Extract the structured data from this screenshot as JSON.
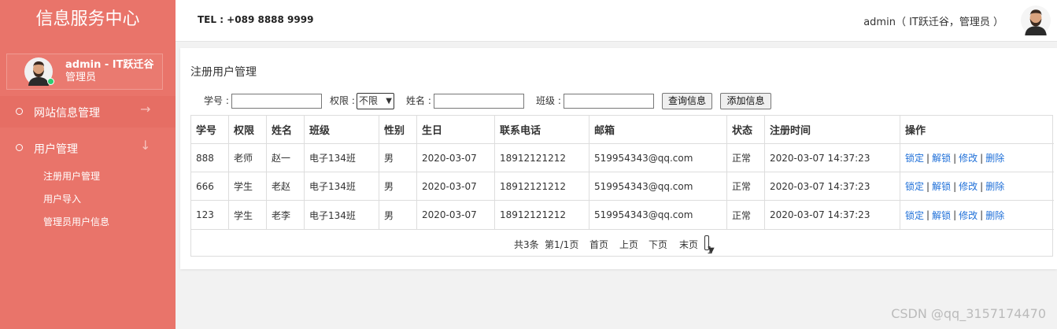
{
  "brand": "信息服务中心",
  "sidebar": {
    "user_name": "admin - IT跃迁谷",
    "user_role": "管理员",
    "nav": [
      {
        "label": "网站信息管理",
        "arrow": "→"
      },
      {
        "label": "用户管理",
        "arrow": "↓"
      }
    ],
    "sub_items": [
      "注册用户管理",
      "用户导入",
      "管理员用户信息"
    ]
  },
  "header": {
    "tel": "TEL : +089 8888 9999",
    "user": "admin（ IT跃迁谷，管理员 ）"
  },
  "panel": {
    "title": "注册用户管理",
    "filters": {
      "id_label": "学号 :",
      "perm_label": "权限 :",
      "perm_value": "不限",
      "name_label": "姓名 :",
      "class_label": "班级 :"
    },
    "buttons": {
      "query": "查询信息",
      "add": "添加信息"
    }
  },
  "table": {
    "headers": [
      "学号",
      "权限",
      "姓名",
      "班级",
      "性别",
      "生日",
      "联系电话",
      "邮箱",
      "状态",
      "注册时间",
      "操作"
    ],
    "rows": [
      [
        "888",
        "老师",
        "赵一",
        "电子134班",
        "男",
        "2020-03-07",
        "18912121212",
        "519954343@qq.com",
        "正常",
        "2020-03-07 14:37:23"
      ],
      [
        "666",
        "学生",
        "老赵",
        "电子134班",
        "男",
        "2020-03-07",
        "18912121212",
        "519954343@qq.com",
        "正常",
        "2020-03-07 14:37:23"
      ],
      [
        "123",
        "学生",
        "老李",
        "电子134班",
        "男",
        "2020-03-07",
        "18912121212",
        "519954343@qq.com",
        "正常",
        "2020-03-07 14:37:23"
      ]
    ],
    "ops": [
      "锁定",
      "解锁",
      "修改",
      "删除"
    ]
  },
  "pager": {
    "total": "共3条",
    "page": "第1/1页",
    "first": "首页",
    "prev": "上页",
    "next": "下页",
    "last": "末页",
    "current": "1"
  },
  "watermark": "CSDN @qq_3157174470",
  "colors": {
    "sidebar": "#e9746a",
    "link": "#1e6fd8",
    "online": "#2ecc71"
  }
}
